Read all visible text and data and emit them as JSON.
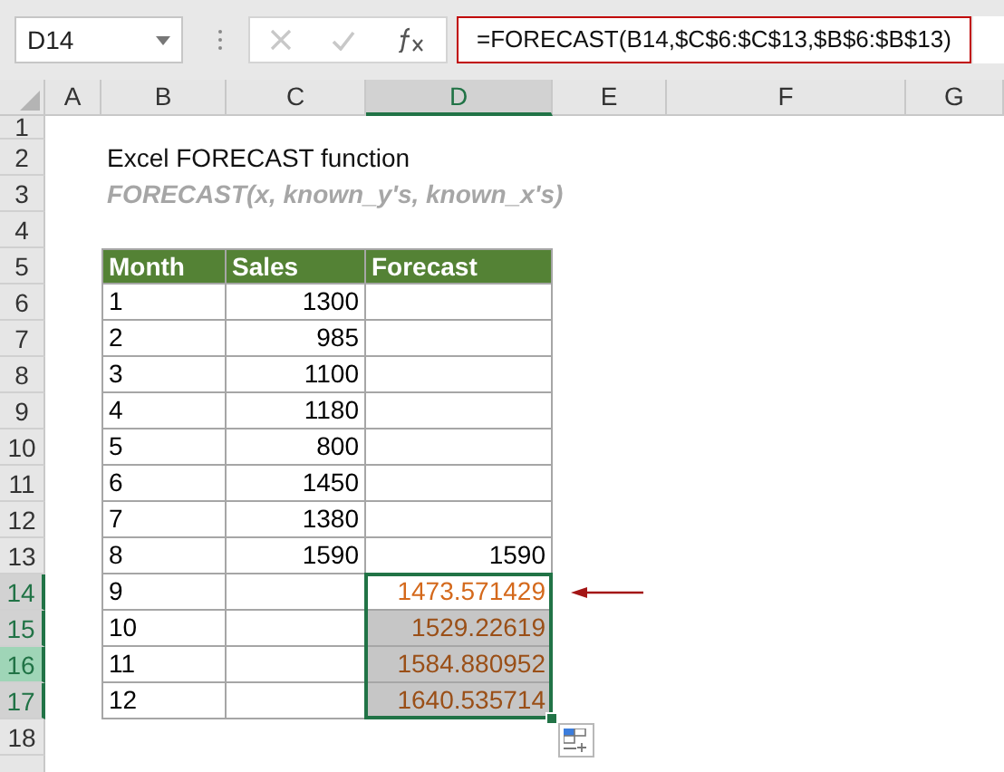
{
  "name_box": "D14",
  "formula": "=FORECAST(B14,$C$6:$C$13,$B$6:$B$13)",
  "columns": [
    {
      "label": "A",
      "selected": false
    },
    {
      "label": "B",
      "selected": false
    },
    {
      "label": "C",
      "selected": false
    },
    {
      "label": "D",
      "selected": true
    },
    {
      "label": "E",
      "selected": false
    },
    {
      "label": "F",
      "selected": false
    },
    {
      "label": "G",
      "selected": false
    }
  ],
  "rows": [
    {
      "label": "1",
      "selected": false,
      "highlighted": false
    },
    {
      "label": "2",
      "selected": false,
      "highlighted": false
    },
    {
      "label": "3",
      "selected": false,
      "highlighted": false
    },
    {
      "label": "4",
      "selected": false,
      "highlighted": false
    },
    {
      "label": "5",
      "selected": false,
      "highlighted": false
    },
    {
      "label": "6",
      "selected": false,
      "highlighted": false
    },
    {
      "label": "7",
      "selected": false,
      "highlighted": false
    },
    {
      "label": "8",
      "selected": false,
      "highlighted": false
    },
    {
      "label": "9",
      "selected": false,
      "highlighted": false
    },
    {
      "label": "10",
      "selected": false,
      "highlighted": false
    },
    {
      "label": "11",
      "selected": false,
      "highlighted": false
    },
    {
      "label": "12",
      "selected": false,
      "highlighted": false
    },
    {
      "label": "13",
      "selected": false,
      "highlighted": false
    },
    {
      "label": "14",
      "selected": true,
      "highlighted": false
    },
    {
      "label": "15",
      "selected": true,
      "highlighted": false
    },
    {
      "label": "16",
      "selected": true,
      "highlighted": true
    },
    {
      "label": "17",
      "selected": true,
      "highlighted": false
    },
    {
      "label": "18",
      "selected": false,
      "highlighted": false
    }
  ],
  "title": "Excel FORECAST function",
  "syntax": "FORECAST(x, known_y's, known_x's)",
  "table": {
    "columns": [
      "Month",
      "Sales",
      "Forecast"
    ],
    "rows": [
      {
        "month": "1",
        "sales": "1300",
        "selected": false
      },
      {
        "month": "2",
        "sales": "985",
        "selected": false
      },
      {
        "month": "3",
        "sales": "1100",
        "selected": false
      },
      {
        "month": "4",
        "sales": "1180",
        "selected": false
      },
      {
        "month": "5",
        "sales": "800",
        "selected": false
      },
      {
        "month": "6",
        "sales": "1450",
        "selected": false
      },
      {
        "month": "7",
        "sales": "1380",
        "selected": false
      },
      {
        "month": "8",
        "sales": "1590",
        "forecast": "1590",
        "selected": false
      },
      {
        "month": "9",
        "forecast": "1473.571429",
        "selected": true,
        "active": true
      },
      {
        "month": "10",
        "forecast": "1529.22619",
        "selected": true,
        "active": false
      },
      {
        "month": "11",
        "forecast": "1584.880952",
        "selected": true,
        "active": false
      },
      {
        "month": "12",
        "forecast": "1640.535714",
        "selected": true,
        "active": false
      }
    ]
  }
}
